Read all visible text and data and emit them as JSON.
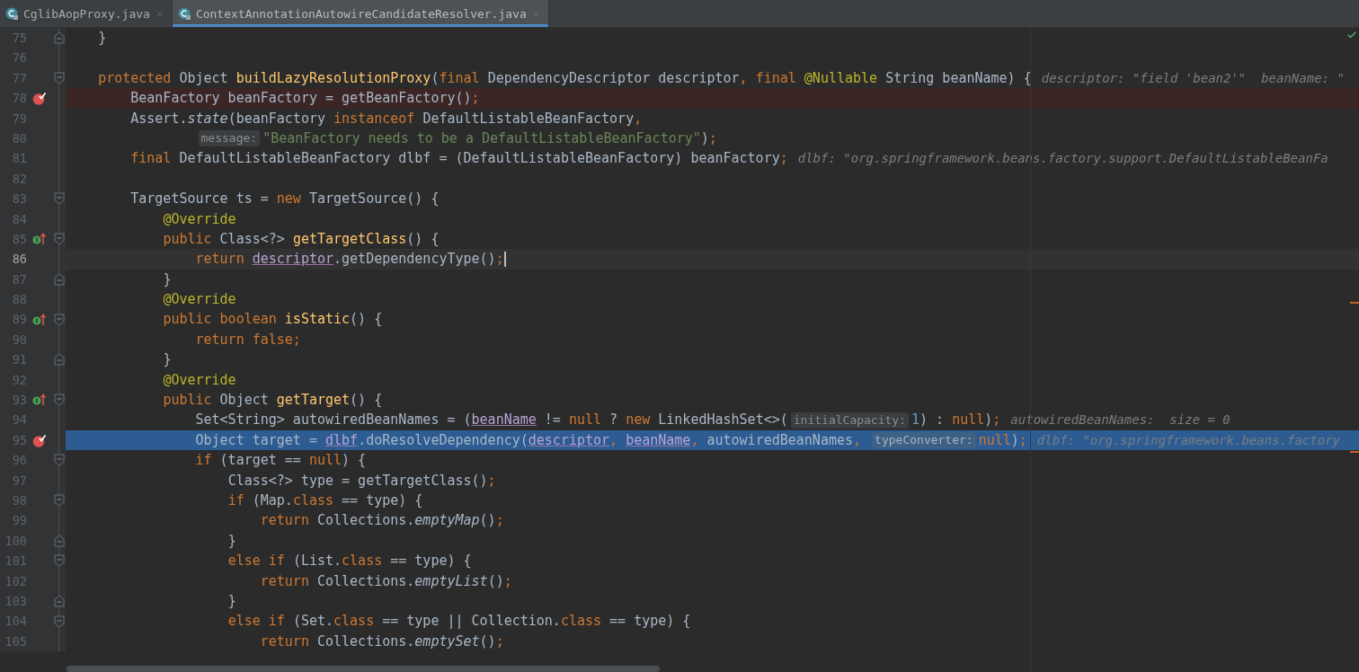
{
  "tabs": [
    {
      "label": "CglibAopProxy.java",
      "selected": false
    },
    {
      "label": "ContextAnnotationAutowireCandidateResolver.java",
      "selected": true
    }
  ],
  "lines": [
    {
      "number": "75",
      "fold_end": true,
      "tokens": [
        {
          "kind": "id",
          "text": "    }"
        }
      ]
    },
    {
      "number": "76"
    },
    {
      "number": "77",
      "fold_start": true,
      "tokens": [
        {
          "kind": "kw",
          "text": "    protected "
        },
        {
          "kind": "id",
          "text": "Object "
        },
        {
          "kind": "fn",
          "text": "buildLazyResolutionProxy"
        },
        {
          "kind": "id",
          "text": "("
        },
        {
          "kind": "kw",
          "text": "final "
        },
        {
          "kind": "id",
          "text": "DependencyDescriptor descriptor"
        },
        {
          "kind": "kw",
          "text": ", final "
        },
        {
          "kind": "ann",
          "text": "@Nullable "
        },
        {
          "kind": "id",
          "text": "String beanName) {"
        },
        {
          "kind": "dbg",
          "text": "descriptor: \"field 'bean2'\"  beanName: \""
        }
      ]
    },
    {
      "number": "78",
      "breakpoint": true,
      "tokens": [
        {
          "kind": "id",
          "text": "        BeanFactory beanFactory = getBeanFactory()"
        },
        {
          "kind": "kw",
          "text": ";"
        }
      ]
    },
    {
      "number": "79",
      "tokens": [
        {
          "kind": "id",
          "text": "        Assert."
        },
        {
          "kind": "it",
          "text": "state"
        },
        {
          "kind": "id",
          "text": "(beanFactory "
        },
        {
          "kind": "kw",
          "text": "instanceof "
        },
        {
          "kind": "id",
          "text": "DefaultListableBeanFactory"
        },
        {
          "kind": "kw",
          "text": ","
        }
      ]
    },
    {
      "number": "80",
      "continuation": true,
      "tokens": [
        {
          "kind": "hint",
          "text": "message:"
        },
        {
          "kind": "str",
          "text": "\"BeanFactory needs to be a DefaultListableBeanFactory\""
        },
        {
          "kind": "id",
          "text": ")"
        },
        {
          "kind": "kw",
          "text": ";"
        }
      ]
    },
    {
      "number": "81",
      "tokens": [
        {
          "kind": "kw",
          "text": "        final "
        },
        {
          "kind": "id",
          "text": "DefaultListableBeanFactory dlbf = (DefaultListableBeanFactory) beanFactory"
        },
        {
          "kind": "kw",
          "text": ";"
        },
        {
          "kind": "dbg",
          "text": "dlbf: \"org.springframework.beans.factory.support.DefaultListableBeanFa"
        }
      ]
    },
    {
      "number": "82"
    },
    {
      "number": "83",
      "fold_start": true,
      "tokens": [
        {
          "kind": "id",
          "text": "        TargetSource ts = "
        },
        {
          "kind": "kw",
          "text": "new "
        },
        {
          "kind": "id",
          "text": "TargetSource() {"
        }
      ]
    },
    {
      "number": "84",
      "tokens": [
        {
          "kind": "ann",
          "text": "            @Override"
        }
      ]
    },
    {
      "number": "85",
      "overrides": true,
      "fold_start": true,
      "tokens": [
        {
          "kind": "kw",
          "text": "            public "
        },
        {
          "kind": "id",
          "text": "Class<?> "
        },
        {
          "kind": "fn",
          "text": "getTargetClass"
        },
        {
          "kind": "id",
          "text": "() {"
        }
      ]
    },
    {
      "number": "86",
      "caret": true,
      "tokens": [
        {
          "kind": "kw",
          "text": "                return "
        },
        {
          "kind": "cap",
          "text": "descriptor"
        },
        {
          "kind": "id",
          "text": ".getDependencyType()"
        },
        {
          "kind": "kw",
          "text": ";"
        }
      ]
    },
    {
      "number": "87",
      "fold_end": true,
      "tokens": [
        {
          "kind": "id",
          "text": "            }"
        }
      ]
    },
    {
      "number": "88",
      "tokens": [
        {
          "kind": "ann",
          "text": "            @Override"
        }
      ]
    },
    {
      "number": "89",
      "overrides": true,
      "fold_start": true,
      "tokens": [
        {
          "kind": "kw",
          "text": "            public boolean "
        },
        {
          "kind": "fn",
          "text": "isStatic"
        },
        {
          "kind": "id",
          "text": "() {"
        }
      ]
    },
    {
      "number": "90",
      "tokens": [
        {
          "kind": "kw",
          "text": "                return false;"
        }
      ]
    },
    {
      "number": "91",
      "fold_end": true,
      "tokens": [
        {
          "kind": "id",
          "text": "            }"
        }
      ]
    },
    {
      "number": "92",
      "tokens": [
        {
          "kind": "ann",
          "text": "            @Override"
        }
      ]
    },
    {
      "number": "93",
      "overrides": true,
      "fold_start": true,
      "tokens": [
        {
          "kind": "kw",
          "text": "            public "
        },
        {
          "kind": "id",
          "text": "Object "
        },
        {
          "kind": "fn",
          "text": "getTarget"
        },
        {
          "kind": "id",
          "text": "() {"
        }
      ]
    },
    {
      "number": "94",
      "tokens": [
        {
          "kind": "id",
          "text": "                Set<String> autowiredBeanNames = ("
        },
        {
          "kind": "cap",
          "text": "beanName"
        },
        {
          "kind": "id",
          "text": " != "
        },
        {
          "kind": "kw",
          "text": "null "
        },
        {
          "kind": "id",
          "text": "? "
        },
        {
          "kind": "kw",
          "text": "new "
        },
        {
          "kind": "id",
          "text": "LinkedHashSet<>("
        },
        {
          "kind": "hint",
          "text": "initialCapacity:"
        },
        {
          "kind": "num",
          "text": "1"
        },
        {
          "kind": "id",
          "text": ") : "
        },
        {
          "kind": "kw",
          "text": "null"
        },
        {
          "kind": "id",
          "text": ")"
        },
        {
          "kind": "kw",
          "text": ";"
        },
        {
          "kind": "dbg",
          "text": "autowiredBeanNames:  size = 0"
        }
      ]
    },
    {
      "number": "95",
      "breakpoint": true,
      "executing": true,
      "tokens": [
        {
          "kind": "id",
          "text": "                Object target = "
        },
        {
          "kind": "cap",
          "text": "dlbf"
        },
        {
          "kind": "id",
          "text": ".doResolveDependency("
        },
        {
          "kind": "cap",
          "text": "descriptor"
        },
        {
          "kind": "kw",
          "text": ", "
        },
        {
          "kind": "cap",
          "text": "beanName"
        },
        {
          "kind": "kw",
          "text": ", "
        },
        {
          "kind": "id",
          "text": "autowiredBeanNames"
        },
        {
          "kind": "kw",
          "text": ", "
        },
        {
          "kind": "hint",
          "text": "typeConverter:"
        },
        {
          "kind": "kw",
          "text": "null"
        },
        {
          "kind": "id",
          "text": ")"
        },
        {
          "kind": "kw",
          "text": ";"
        },
        {
          "kind": "dbg",
          "text": "dlbf: \"org.springframework.beans.factory"
        }
      ]
    },
    {
      "number": "96",
      "fold_start": true,
      "tokens": [
        {
          "kind": "kw",
          "text": "                if "
        },
        {
          "kind": "id",
          "text": "(target == "
        },
        {
          "kind": "kw",
          "text": "null"
        },
        {
          "kind": "id",
          "text": ") {"
        }
      ]
    },
    {
      "number": "97",
      "tokens": [
        {
          "kind": "id",
          "text": "                    Class<?> type = getTargetClass()"
        },
        {
          "kind": "kw",
          "text": ";"
        }
      ]
    },
    {
      "number": "98",
      "fold_start": true,
      "tokens": [
        {
          "kind": "kw",
          "text": "                    if "
        },
        {
          "kind": "id",
          "text": "(Map."
        },
        {
          "kind": "kw",
          "text": "class "
        },
        {
          "kind": "id",
          "text": "== type) {"
        }
      ]
    },
    {
      "number": "99",
      "tokens": [
        {
          "kind": "kw",
          "text": "                        return "
        },
        {
          "kind": "id",
          "text": "Collections."
        },
        {
          "kind": "it",
          "text": "emptyMap"
        },
        {
          "kind": "id",
          "text": "()"
        },
        {
          "kind": "kw",
          "text": ";"
        }
      ]
    },
    {
      "number": "100",
      "fold_end": true,
      "tokens": [
        {
          "kind": "id",
          "text": "                    }"
        }
      ]
    },
    {
      "number": "101",
      "fold_start": true,
      "tokens": [
        {
          "kind": "kw",
          "text": "                    else if "
        },
        {
          "kind": "id",
          "text": "(List."
        },
        {
          "kind": "kw",
          "text": "class "
        },
        {
          "kind": "id",
          "text": "== type) {"
        }
      ]
    },
    {
      "number": "102",
      "tokens": [
        {
          "kind": "kw",
          "text": "                        return "
        },
        {
          "kind": "id",
          "text": "Collections."
        },
        {
          "kind": "it",
          "text": "emptyList"
        },
        {
          "kind": "id",
          "text": "()"
        },
        {
          "kind": "kw",
          "text": ";"
        }
      ]
    },
    {
      "number": "103",
      "fold_end": true,
      "tokens": [
        {
          "kind": "id",
          "text": "                    }"
        }
      ]
    },
    {
      "number": "104",
      "fold_start": true,
      "tokens": [
        {
          "kind": "kw",
          "text": "                    else if "
        },
        {
          "kind": "id",
          "text": "(Set."
        },
        {
          "kind": "kw",
          "text": "class "
        },
        {
          "kind": "id",
          "text": "== type || Collection."
        },
        {
          "kind": "kw",
          "text": "class "
        },
        {
          "kind": "id",
          "text": "== type) {"
        }
      ]
    },
    {
      "number": "105",
      "tokens": [
        {
          "kind": "kw",
          "text": "                        return "
        },
        {
          "kind": "id",
          "text": "Collections."
        },
        {
          "kind": "it",
          "text": "emptySet"
        },
        {
          "kind": "id",
          "text": "()"
        },
        {
          "kind": "kw",
          "text": ";"
        }
      ]
    }
  ]
}
